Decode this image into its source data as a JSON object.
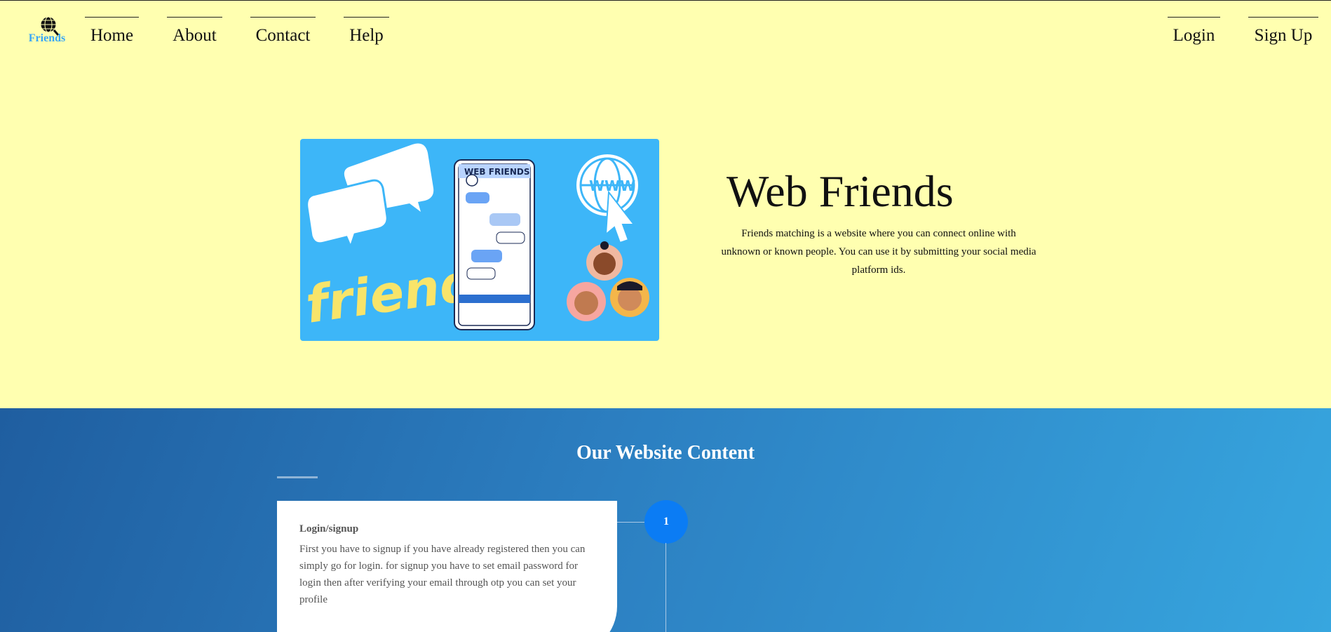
{
  "logo": {
    "text": "Friends",
    "icon": "globe-magnifier-icon"
  },
  "nav": {
    "left": [
      "Home",
      "About",
      "Contact",
      "Help"
    ],
    "right": [
      "Login",
      "Sign Up"
    ]
  },
  "hero": {
    "image_title": "WEB FRIENDS",
    "image_word": "friends",
    "image_globe_text": "WWW",
    "title": "Web Friends",
    "description": "Friends matching is a website where you can connect online with unknown or known people. You can use it by submitting your social media platform ids."
  },
  "content": {
    "title": "Our Website Content",
    "steps": [
      {
        "number": "1",
        "title": "Login/signup",
        "body": "First you have to signup if you have already registered then you can simply go for login. for signup you have to set email password for login then after verifying your email through otp you can set your profile"
      }
    ]
  },
  "colors": {
    "page_bg": "#ffffb0",
    "hero_image_bg": "#3db6f8",
    "section_gradient_start": "#1f5ea0",
    "section_gradient_end": "#37a6df",
    "step_circle": "#0b7cf4",
    "logo_text": "#3aa7f5",
    "friends_word": "#f8e46a"
  }
}
